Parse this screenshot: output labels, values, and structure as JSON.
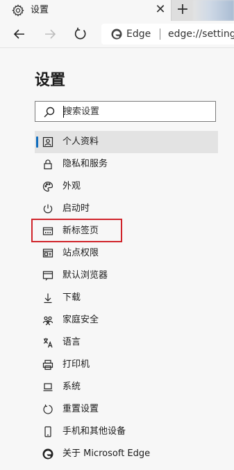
{
  "tab": {
    "title": "设置",
    "close_glyph": "✕",
    "icon": "gear-icon"
  },
  "newtab": {
    "glyph": "+"
  },
  "toolbar": {
    "back_icon": "back-arrow-icon",
    "forward_icon": "forward-arrow-icon",
    "refresh_icon": "refresh-icon",
    "site_label": "Edge",
    "url": "edge://settings"
  },
  "page": {
    "title": "设置"
  },
  "search": {
    "placeholder": "搜索设置"
  },
  "nav": [
    {
      "label": "个人资料",
      "icon": "profile-icon",
      "active": true
    },
    {
      "label": "隐私和服务",
      "icon": "lock-icon"
    },
    {
      "label": "外观",
      "icon": "palette-icon"
    },
    {
      "label": "启动时",
      "icon": "power-icon"
    },
    {
      "label": "新标签页",
      "icon": "new-tab-page-icon",
      "highlighted": true
    },
    {
      "label": "站点权限",
      "icon": "site-permissions-icon"
    },
    {
      "label": "默认浏览器",
      "icon": "default-browser-icon"
    },
    {
      "label": "下载",
      "icon": "download-icon"
    },
    {
      "label": "家庭安全",
      "icon": "family-icon"
    },
    {
      "label": "语言",
      "icon": "language-icon"
    },
    {
      "label": "打印机",
      "icon": "printer-icon"
    },
    {
      "label": "系统",
      "icon": "laptop-icon"
    },
    {
      "label": "重置设置",
      "icon": "reset-icon"
    },
    {
      "label": "手机和其他设备",
      "icon": "phone-icon"
    },
    {
      "label": "关于 Microsoft Edge",
      "icon": "edge-logo-icon"
    }
  ],
  "colors": {
    "accent": "#0f6cbd",
    "highlight": "#d0232a"
  }
}
